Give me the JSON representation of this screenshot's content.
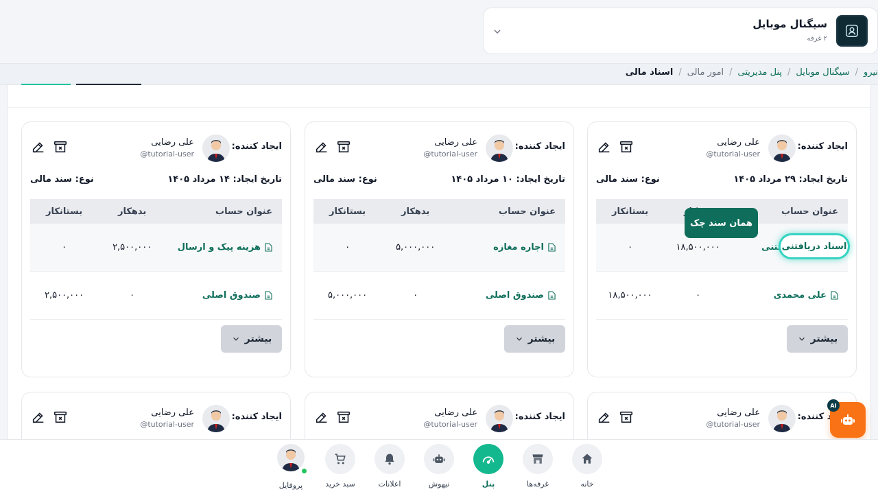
{
  "store": {
    "name": "سیگنال موبایل",
    "subtitle": "۲ غرفه",
    "logo_icon": "user-square-icon"
  },
  "breadcrumb": [
    {
      "label": "نیرو",
      "type": "link"
    },
    {
      "label": "سیگنال موبایل",
      "type": "link"
    },
    {
      "label": "پنل مدیریتی",
      "type": "link"
    },
    {
      "label": "امور مالی",
      "type": "muted"
    },
    {
      "label": "اسناد مالی",
      "type": "current"
    }
  ],
  "card_labels": {
    "creator": "ایجاد کننده:",
    "more": "بیشتر",
    "col_account": "عنوان حساب",
    "col_debit": "بدهکار",
    "col_credit": "بستانکار"
  },
  "cards": [
    {
      "user_name": "علی رضایی",
      "user_handle": "@tutorial-user",
      "date": "تاریخ ایجاد: ۲۹ مرداد ۱۴۰۵",
      "type": "نوع: سند مالی",
      "rows": [
        {
          "account": "اسناد دریافتنی",
          "debit": "۱۸,۵۰۰,۰۰۰",
          "credit": "۰"
        },
        {
          "account": "علی محمدی",
          "debit": "۰",
          "credit": "۱۸,۵۰۰,۰۰۰"
        }
      ]
    },
    {
      "user_name": "علی رضایی",
      "user_handle": "@tutorial-user",
      "date": "تاریخ ایجاد: ۱۰ مرداد ۱۴۰۵",
      "type": "نوع: سند مالی",
      "rows": [
        {
          "account": "اجاره مغازه",
          "debit": "۵,۰۰۰,۰۰۰",
          "credit": "۰"
        },
        {
          "account": "صندوق اصلی",
          "debit": "۰",
          "credit": "۵,۰۰۰,۰۰۰"
        }
      ]
    },
    {
      "user_name": "علی رضایی",
      "user_handle": "@tutorial-user",
      "date": "تاریخ ایجاد: ۱۴ مرداد ۱۴۰۵",
      "type": "نوع: سند مالی",
      "rows": [
        {
          "account": "هزینه پیک و ارسال",
          "debit": "۲,۵۰۰,۰۰۰",
          "credit": "۰"
        },
        {
          "account": "صندوق اصلی",
          "debit": "۰",
          "credit": "۲,۵۰۰,۰۰۰"
        }
      ]
    },
    {
      "user_name": "علی رضایی",
      "user_handle": "@tutorial-user"
    },
    {
      "user_name": "علی رضایی",
      "user_handle": "@tutorial-user"
    },
    {
      "user_name": "علی رضایی",
      "user_handle": "@tutorial-user"
    }
  ],
  "tooltip": {
    "text": "همان سند چک"
  },
  "highlight": {
    "text": "اسناد دریافتنی"
  },
  "ai_button": {
    "badge": "AI",
    "icon": "robot-icon"
  },
  "bottom_nav": [
    {
      "label": "خانه",
      "icon": "home-icon",
      "active": false
    },
    {
      "label": "غرفه‌ها",
      "icon": "store-icon",
      "active": false
    },
    {
      "label": "پنل",
      "icon": "dashboard-gauge-icon",
      "active": true
    },
    {
      "label": "نیهوش",
      "icon": "robot-icon",
      "active": false
    },
    {
      "label": "اعلانات",
      "icon": "bell-icon",
      "active": false
    },
    {
      "label": "سبد خرید",
      "icon": "cart-icon",
      "active": false
    },
    {
      "label": "پروفایل",
      "icon": "avatar",
      "active": false
    }
  ],
  "colors": {
    "accent": "#14b88f",
    "link": "#0d6e5a",
    "tooltip_bg": "#0f6e5b",
    "highlight_ring": "#34d3c1",
    "ai_button": "#f97316"
  }
}
